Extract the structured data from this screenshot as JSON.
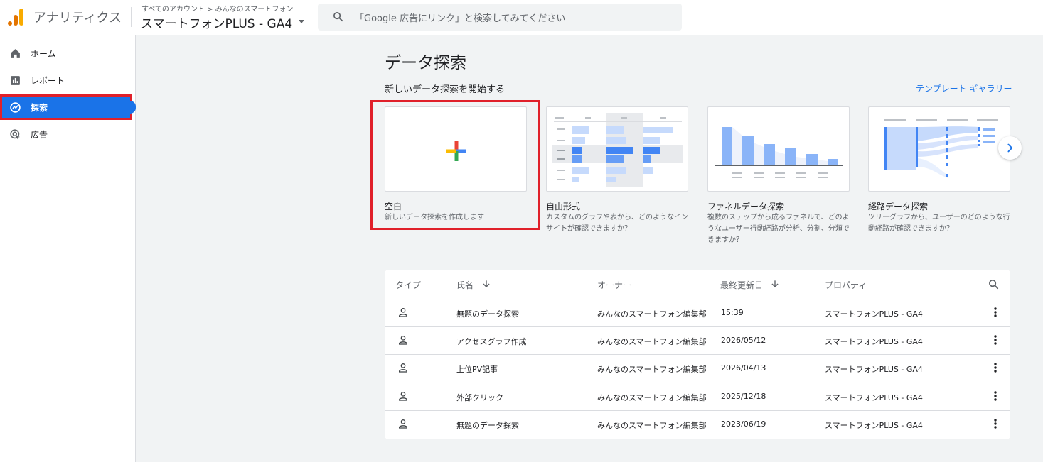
{
  "header": {
    "app_name": "アナリティクス",
    "breadcrumb": "すべてのアカウント > みんなのスマートフォン",
    "property": "スマートフォンPLUS - GA4",
    "search_placeholder": "「Google 広告にリンク」と検索してみてください"
  },
  "sidebar": {
    "items": [
      {
        "label": "ホーム",
        "icon": "home-icon"
      },
      {
        "label": "レポート",
        "icon": "reports-icon"
      },
      {
        "label": "探索",
        "icon": "explore-icon",
        "active": true
      },
      {
        "label": "広告",
        "icon": "advertising-icon"
      }
    ]
  },
  "main": {
    "title": "データ探索",
    "subtitle": "新しいデータ探索を開始する",
    "template_gallery": "テンプレート ギャラリー",
    "templates": [
      {
        "title": "空白",
        "description": "新しいデータ探索を作成します"
      },
      {
        "title": "自由形式",
        "description": "カスタムのグラフや表から、どのようなインサイトが確認できますか？"
      },
      {
        "title": "ファネルデータ探索",
        "description": "複数のステップから成るファネルで、どのようなユーザー行動経路が分析、分割、分類できますか？"
      },
      {
        "title": "経路データ探索",
        "description": "ツリーグラフから、ユーザーのどのような行動経路が確認できますか？"
      }
    ]
  },
  "table": {
    "headers": {
      "type": "タイプ",
      "name": "氏名",
      "owner": "オーナー",
      "updated": "最終更新日",
      "property": "プロパティ"
    },
    "rows": [
      {
        "name": "無題のデータ探索",
        "owner": "みんなのスマートフォン編集部",
        "updated": "15:39",
        "property": "スマートフォンPLUS - GA4"
      },
      {
        "name": "アクセスグラフ作成",
        "owner": "みんなのスマートフォン編集部",
        "updated": "2026/05/12",
        "property": "スマートフォンPLUS - GA4"
      },
      {
        "name": "上位PV記事",
        "owner": "みんなのスマートフォン編集部",
        "updated": "2026/04/13",
        "property": "スマートフォンPLUS - GA4"
      },
      {
        "name": "外部クリック",
        "owner": "みんなのスマートフォン編集部",
        "updated": "2025/12/18",
        "property": "スマートフォンPLUS - GA4"
      },
      {
        "name": "無題のデータ探索",
        "owner": "みんなのスマートフォン編集部",
        "updated": "2023/06/19",
        "property": "スマートフォンPLUS - GA4"
      }
    ]
  },
  "colors": {
    "accent": "#1a73e8",
    "highlight": "#e0202a",
    "logo_orange": "#e37400",
    "logo_yellow": "#f9ab00"
  }
}
